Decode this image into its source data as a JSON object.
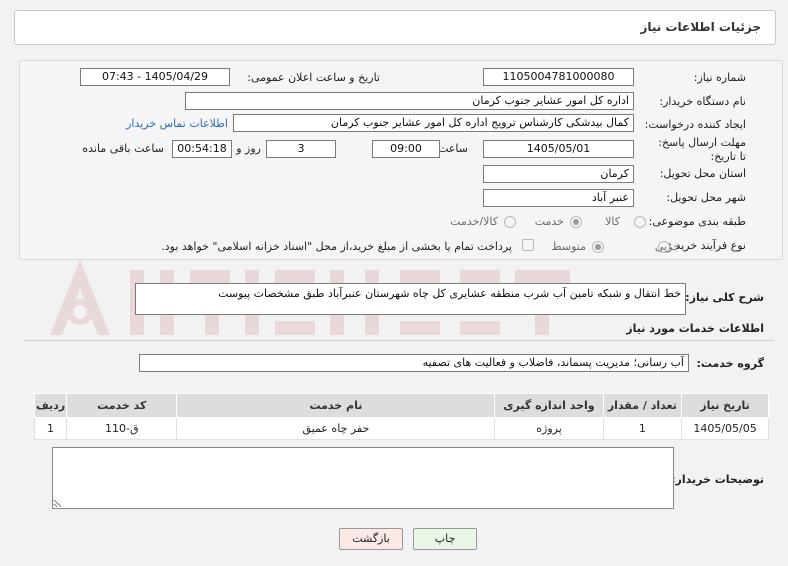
{
  "header": {
    "title": "جزئیات اطلاعات نیاز"
  },
  "form": {
    "need_number": {
      "label": "شماره نیاز:",
      "value": "1105004781000080"
    },
    "announce": {
      "label": "تاریخ و ساعت اعلان عمومی:",
      "value": "1405/04/29 - 07:43"
    },
    "buyer_org": {
      "label": "نام دستگاه خریدار:",
      "value": "اداره کل امور عشایر جنوب کرمان"
    },
    "requester": {
      "label": "ایجاد کننده درخواست:",
      "value": "کمال بیدشکی کارشناس ترویج اداره کل امور عشایر جنوب کرمان",
      "contact_link": "اطلاعات تماس خریدار"
    },
    "deadline": {
      "label": "مهلت ارسال پاسخ: تا تاریخ:",
      "date": "1405/05/01",
      "time_label": "ساعت",
      "time": "09:00",
      "days": "3",
      "days_label": "روز و",
      "remaining": "00:54:18",
      "remaining_label": "ساعت باقی مانده"
    },
    "province": {
      "label": "استان محل تحویل:",
      "value": "کرمان"
    },
    "city": {
      "label": "شهر محل تحویل:",
      "value": "عنبر آباد"
    },
    "category": {
      "label": "طبقه بندی موضوعی:",
      "options": [
        "کالا",
        "خدمت",
        "کالا/خدمت"
      ],
      "selected": "خدمت"
    },
    "process": {
      "label": "نوع فرآیند خرید :",
      "options": [
        "جزیی",
        "متوسط"
      ],
      "selected": "متوسط",
      "note": "پرداخت تمام یا بخشی از مبلغ خرید،از محل \"اسناد خزانه اسلامی\" خواهد بود."
    }
  },
  "description": {
    "label": "شرح کلی نیاز:",
    "value": "خط انتقال و شبکه تامین آب شرب منطقه عشایری کل چاه  شهرستان عنبرآباد  طبق مشخصات پیوست"
  },
  "services": {
    "section_title": "اطلاعات خدمات مورد نیاز",
    "group_label": "گروه خدمت:",
    "group_value": "آب رسانی؛ مدیریت پسماند، فاضلاب و فعالیت های تصفیه",
    "columns": [
      "ردیف",
      "کد خدمت",
      "نام خدمت",
      "واحد اندازه گیری",
      "تعداد / مقدار",
      "تاریخ نیاز"
    ],
    "rows": [
      [
        "1",
        "ق-110",
        "حفر چاه عمیق",
        "پروژه",
        "1",
        "1405/05/05"
      ]
    ]
  },
  "buyer_notes": {
    "label": "توضیحات خریدار:",
    "value": ""
  },
  "buttons": {
    "print": "چاپ",
    "back": "بازگشت"
  },
  "colors": {
    "link": "#2a6fb5",
    "back_button_bg": "#fde8e8",
    "print_button_bg": "#eaf7e6",
    "table_header_bg": "#dddddd"
  }
}
